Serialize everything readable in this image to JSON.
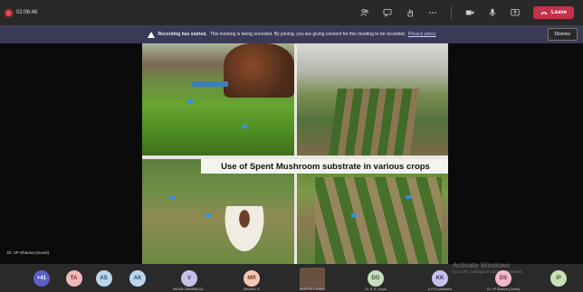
{
  "topbar": {
    "timer": "02:06:46",
    "leave_label": "Leave",
    "tools": [
      "people-icon",
      "chat-icon",
      "raise-hand-icon",
      "more-icon",
      "camera-icon",
      "mic-icon",
      "share-icon"
    ]
  },
  "banner": {
    "bold": "Recording has started.",
    "text": "This meeting is being recorded. By joining, you are giving consent for this meeting to be recorded.",
    "policy_link": "Privacy policy",
    "dismiss_label": "Dismiss"
  },
  "slide": {
    "caption": "Use of Spent Mushroom substrate in various crops"
  },
  "presenter_name": "Dr. VP Sharma (Guest)",
  "participants": [
    {
      "initials": "+41",
      "name": "",
      "color": "#5b5fc7",
      "text_color": "#ffffff"
    },
    {
      "initials": "TA",
      "name": "",
      "color": "#f1b8b8",
      "text_color": "#6b2b2b"
    },
    {
      "initials": "AS",
      "name": "",
      "color": "#b9d6ec",
      "text_color": "#2c4a66"
    },
    {
      "initials": "AK",
      "name": "",
      "color": "#b9d6ec",
      "text_color": "#2c4a66"
    },
    {
      "initials": "V",
      "name": "VIKASH SHARMA (G...",
      "color": "#c8c0ea",
      "text_color": "#3e3466"
    },
    {
      "initials": "MR",
      "name": "MANVEL K",
      "color": "#f3c8b8",
      "text_color": "#7a3b22"
    },
    {
      "initials": "",
      "name": "RAKESH KUMAR",
      "color": "#6a5040",
      "text_color": "#ffffff"
    },
    {
      "initials": "DG",
      "name": "Dr. S. K. Goyal",
      "color": "#c8dcc0",
      "text_color": "#3b5530"
    },
    {
      "initials": "KK",
      "name": "K.P.S Kushwaha",
      "color": "#c8c0ea",
      "text_color": "#3e3466"
    },
    {
      "initials": "DS",
      "name": "Dr. VP Sharma (Guest)",
      "color": "#f0b8c8",
      "text_color": "#6e2a40"
    },
    {
      "initials": "IP",
      "name": "",
      "color": "#c8e0b8",
      "text_color": "#3e5a2c"
    }
  ],
  "watermark": {
    "title": "Activate Windows",
    "subtitle": "Go to PC settings to activate Windows."
  }
}
